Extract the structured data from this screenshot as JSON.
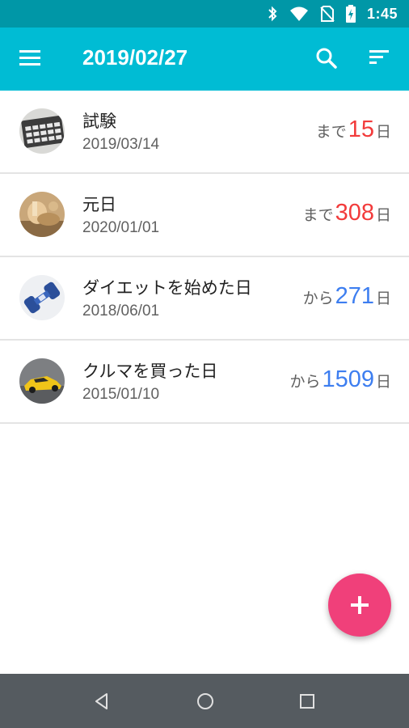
{
  "status_bar": {
    "time": "1:45",
    "icons": [
      "bluetooth-icon",
      "wifi-icon",
      "no-sim-icon",
      "battery-icon"
    ]
  },
  "app_bar": {
    "title": "2019/02/27",
    "color": "#00bcd4",
    "icons": [
      "menu-icon",
      "search-icon",
      "sort-icon"
    ]
  },
  "items": [
    {
      "title": "試験",
      "date": "2019/03/14",
      "prefix": "まで",
      "count": "15",
      "suffix": "日",
      "count_color": "#f23b3b",
      "image": "calculator"
    },
    {
      "title": "元日",
      "date": "2020/01/01",
      "prefix": "まで",
      "count": "308",
      "suffix": "日",
      "count_color": "#f23b3b",
      "image": "new-year"
    },
    {
      "title": "ダイエットを始めた日",
      "date": "2018/06/01",
      "prefix": "から",
      "count": "271",
      "suffix": "日",
      "count_color": "#3d7ef0",
      "image": "dumbbell"
    },
    {
      "title": "クルマを買った日",
      "date": "2015/01/10",
      "prefix": "から",
      "count": "1509",
      "suffix": "日",
      "count_color": "#3d7ef0",
      "image": "car"
    }
  ],
  "fab": {
    "icon": "plus-icon",
    "color": "#f0407a"
  },
  "nav_bar": {
    "icons": [
      "back-icon",
      "home-icon",
      "recents-icon"
    ]
  }
}
